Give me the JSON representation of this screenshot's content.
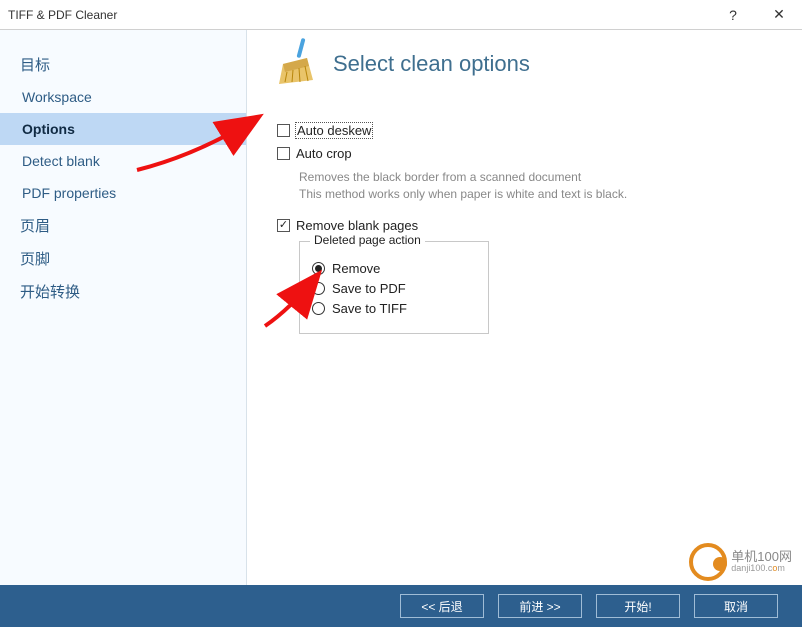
{
  "window": {
    "title": "TIFF & PDF Cleaner"
  },
  "sidebar": {
    "items": [
      {
        "label": "目标"
      },
      {
        "label": "Workspace"
      },
      {
        "label": "Options"
      },
      {
        "label": "Detect blank"
      },
      {
        "label": "PDF properties"
      },
      {
        "label": "页眉"
      },
      {
        "label": "页脚"
      },
      {
        "label": "开始转换"
      }
    ]
  },
  "main": {
    "heading": "Select clean options",
    "autoDeskew": {
      "label": "Auto deskew",
      "checked": false
    },
    "autoCrop": {
      "label": "Auto crop",
      "checked": false,
      "hint1": "Removes the black border from a scanned document",
      "hint2": "This method works only when paper is white and text is black."
    },
    "removeBlank": {
      "label": "Remove blank pages",
      "checked": true
    },
    "deletedAction": {
      "legend": "Deleted page action",
      "options": [
        {
          "label": "Remove",
          "selected": true
        },
        {
          "label": "Save to PDF",
          "selected": false
        },
        {
          "label": "Save to TIFF",
          "selected": false
        }
      ]
    }
  },
  "footer": {
    "back": "<<  后退",
    "forward": "前进  >>",
    "start": "开始!",
    "cancel": "取消"
  },
  "watermark": {
    "line1": "单机100网",
    "line2_a": "danji100.c",
    "line2_b": "o",
    "line2_c": "m"
  }
}
